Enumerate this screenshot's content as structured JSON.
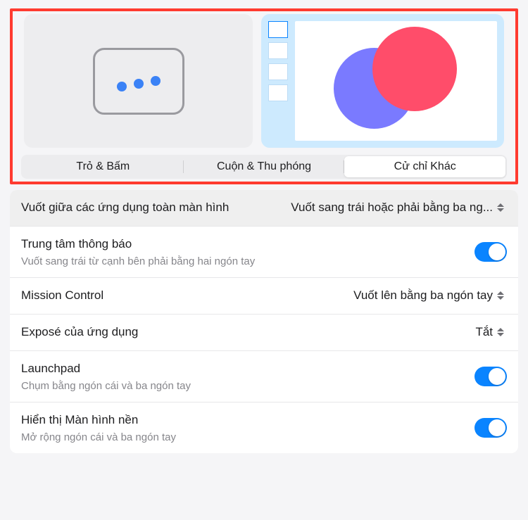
{
  "tabs": {
    "point_click": "Trỏ & Bấm",
    "scroll_zoom": "Cuộn & Thu phóng",
    "more_gestures": "Cử chỉ Khác"
  },
  "rows": {
    "swipe_apps": {
      "title": "Vuốt giữa các ứng dụng toàn màn hình",
      "value": "Vuốt sang trái hoặc phải bằng ba ng..."
    },
    "notification_center": {
      "title": "Trung tâm thông báo",
      "sub": "Vuốt sang trái từ cạnh bên phải bằng hai ngón tay"
    },
    "mission_control": {
      "title": "Mission Control",
      "value": "Vuốt lên bằng ba ngón tay"
    },
    "app_expose": {
      "title": "Exposé của ứng dụng",
      "value": "Tắt"
    },
    "launchpad": {
      "title": "Launchpad",
      "sub": "Chụm bằng ngón cái và ba ngón tay"
    },
    "show_desktop": {
      "title": "Hiển thị Màn hình nền",
      "sub": "Mở rộng ngón cái và ba ngón tay"
    }
  }
}
